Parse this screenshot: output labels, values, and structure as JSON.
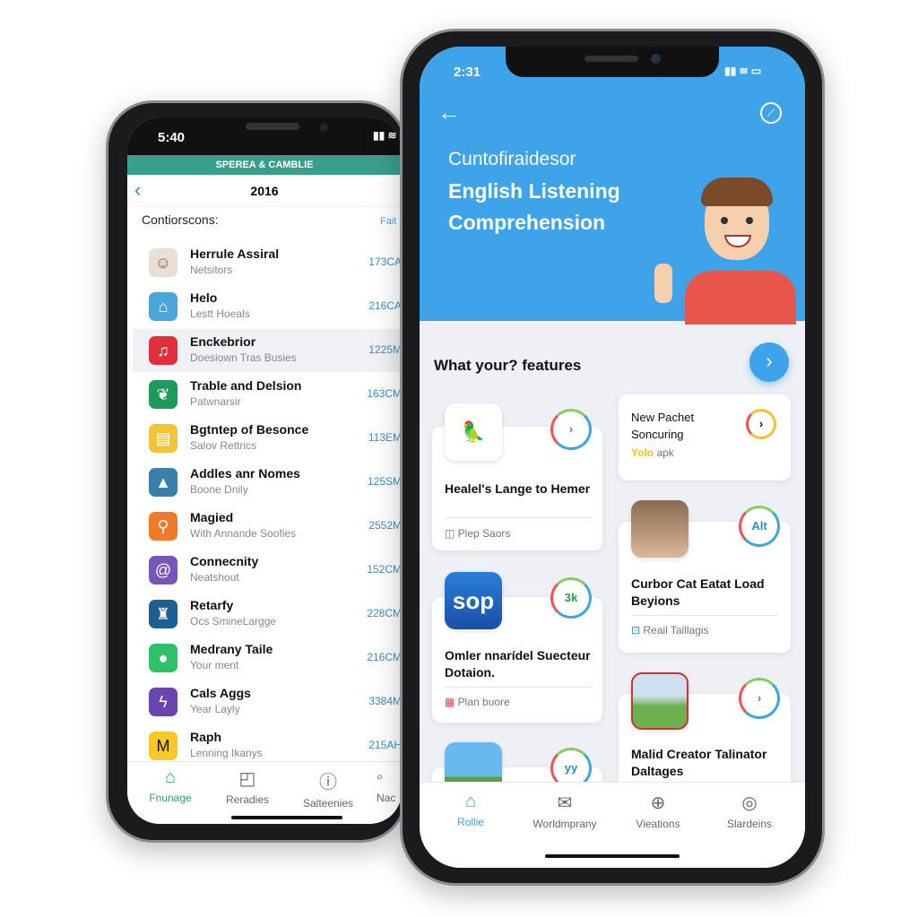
{
  "back_phone": {
    "status_time": "5:40",
    "banner": "SPEREA & CAMBLIE",
    "nav_title": "2016",
    "section_label": "Contiorscons:",
    "section_action": "Fait",
    "items": [
      {
        "title": "Herrule Assiral",
        "subtitle": "Netsitors",
        "value": "173CA",
        "icon": "person-avatar",
        "color": "#e8e0d8"
      },
      {
        "title": "Helo",
        "subtitle": "Lestt Hoeals",
        "value": "216CA",
        "icon": "building-icon",
        "color": "#4aa6d6"
      },
      {
        "title": "Enckebrior",
        "subtitle": "Doesiown Tras Busies",
        "value": "1225M",
        "icon": "music-note-icon",
        "color": "#e0303e"
      },
      {
        "title": "Trable and Delsion",
        "subtitle": "Patwnarsir",
        "value": "163CM",
        "icon": "leaf-icon",
        "color": "#1e9a5a"
      },
      {
        "title": "Bgtntep of Besonce",
        "subtitle": "Salov Rettrics",
        "value": "113EM",
        "icon": "store-icon",
        "color": "#f3c43a"
      },
      {
        "title": "Addles anr Nomes",
        "subtitle": "Boone Dnily",
        "value": "125SM",
        "icon": "landscape-icon",
        "color": "#3a7fa8"
      },
      {
        "title": "Magied",
        "subtitle": "With Annande Soofies",
        "value": "2552M",
        "icon": "location-pin-icon",
        "color": "#f07a2a"
      },
      {
        "title": "Connecnity",
        "subtitle": "Neatshout",
        "value": "152CM",
        "icon": "spiral-icon",
        "color": "#7a55b8"
      },
      {
        "title": "Retarfy",
        "subtitle": "Ocs SmineLargge",
        "value": "228CM",
        "icon": "castle-icon",
        "color": "#1f5f8f"
      },
      {
        "title": "Medrany Taile",
        "subtitle": "Your ment",
        "value": "216CM",
        "icon": "chat-bubble-icon",
        "color": "#2fc06a"
      },
      {
        "title": "Cals Aggs",
        "subtitle": "Year Layly",
        "value": "3384M",
        "icon": "lightning-icon",
        "color": "#6a45b0"
      },
      {
        "title": "Raph",
        "subtitle": "Lenning Ikanys",
        "value": "215AH",
        "icon": "m-logo-icon",
        "color": "#f6c928"
      }
    ],
    "bottom_nav": [
      {
        "label": "Fnunage",
        "icon": "home-icon",
        "active": true
      },
      {
        "label": "Reradies",
        "icon": "bag-icon"
      },
      {
        "label": "Salteenies",
        "icon": "alert-icon"
      },
      {
        "label": "Nac",
        "icon": "more-icon"
      }
    ],
    "accent": "#3a9e8c"
  },
  "front_phone": {
    "status_time": "2:31",
    "header_color": "#3ea3e8",
    "header_subtitle": "Cuntofiraidesor",
    "header_title_line1": "English Listening",
    "header_title_line2": "Comprehension",
    "section_title": "What your? features",
    "cards": [
      {
        "title": "Healel's Lange to Hemer",
        "footer": "Plep Saors",
        "ring": "›",
        "icon": "parrot-icon"
      },
      {
        "title": "New Pachet Soncuring",
        "footer_highlight": "Yolo",
        "footer": "apk",
        "ring": "›"
      },
      {
        "title": "Curbor Cat Eatat Load Beyions",
        "footer": "Reail Talllagis",
        "ring": "Alt",
        "icon": "woman-photo"
      },
      {
        "title": "Omler nnarídel Suecteur Dotaion.",
        "footer": "Plan buore",
        "ring": "3k",
        "icon_text": "sop"
      },
      {
        "title": "Malid Creator Talinator Daltages",
        "ring": "›",
        "icon": "girl-photo"
      },
      {
        "ring": "yy",
        "icon": "boy-illustration"
      }
    ],
    "bottom_nav": [
      {
        "label": "Rollie",
        "icon": "home-icon",
        "active": true
      },
      {
        "label": "Worldmprany",
        "icon": "mail-icon"
      },
      {
        "label": "Vieations",
        "icon": "plus-circle-icon"
      },
      {
        "label": "Slardeins",
        "icon": "webcam-icon"
      }
    ]
  }
}
